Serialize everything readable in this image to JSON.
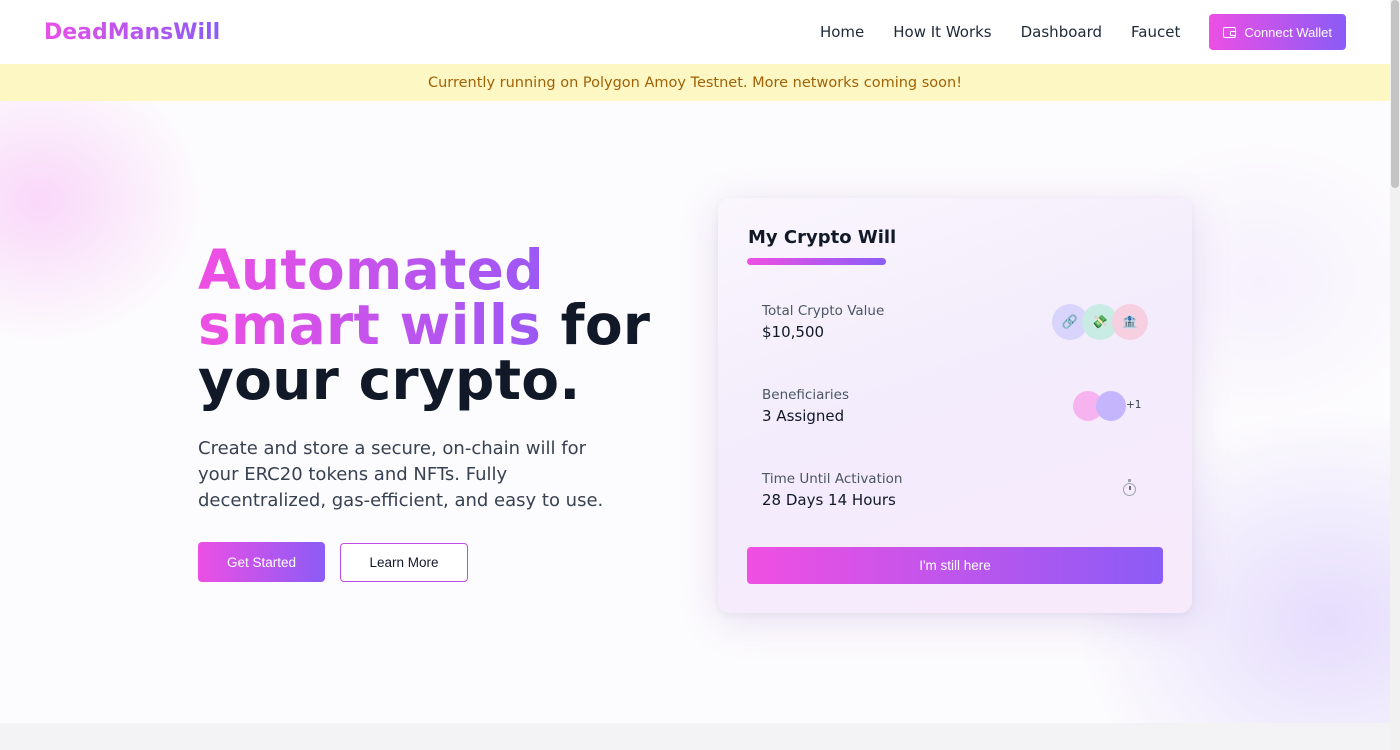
{
  "header": {
    "logo": "DeadMansWill",
    "nav": [
      "Home",
      "How It Works",
      "Dashboard",
      "Faucet"
    ],
    "connect_label": "Connect Wallet"
  },
  "banner": {
    "text": "Currently running on Polygon Amoy Testnet. More networks coming soon!"
  },
  "hero": {
    "headline_grad_1": "Automated",
    "headline_grad_2": "smart wills",
    "headline_rest_1": " for",
    "headline_rest_2": "your crypto.",
    "subtitle": "Create and store a secure, on-chain will for your ERC20 tokens and NFTs. Fully decentralized, gas-efficient, and easy to use.",
    "primary_cta": "Get Started",
    "secondary_cta": "Learn More"
  },
  "card": {
    "title": "My Crypto Will",
    "rows": [
      {
        "label": "Total Crypto Value",
        "value": "$10,500"
      },
      {
        "label": "Beneficiaries",
        "value": "3 Assigned"
      },
      {
        "label": "Time Until Activation",
        "value": "28 Days 14 Hours"
      }
    ],
    "token_icons": [
      "🔗",
      "💸",
      "🏦"
    ],
    "extra_beneficiaries": "+1",
    "action_label": "I'm still here"
  },
  "icons": {
    "wallet": "wallet-icon",
    "timer": "timer-icon"
  },
  "colors": {
    "accent_start": "#ec4fe4",
    "accent_end": "#8b5cf6",
    "banner_bg": "#fdf7c3",
    "banner_text": "#a16207"
  }
}
